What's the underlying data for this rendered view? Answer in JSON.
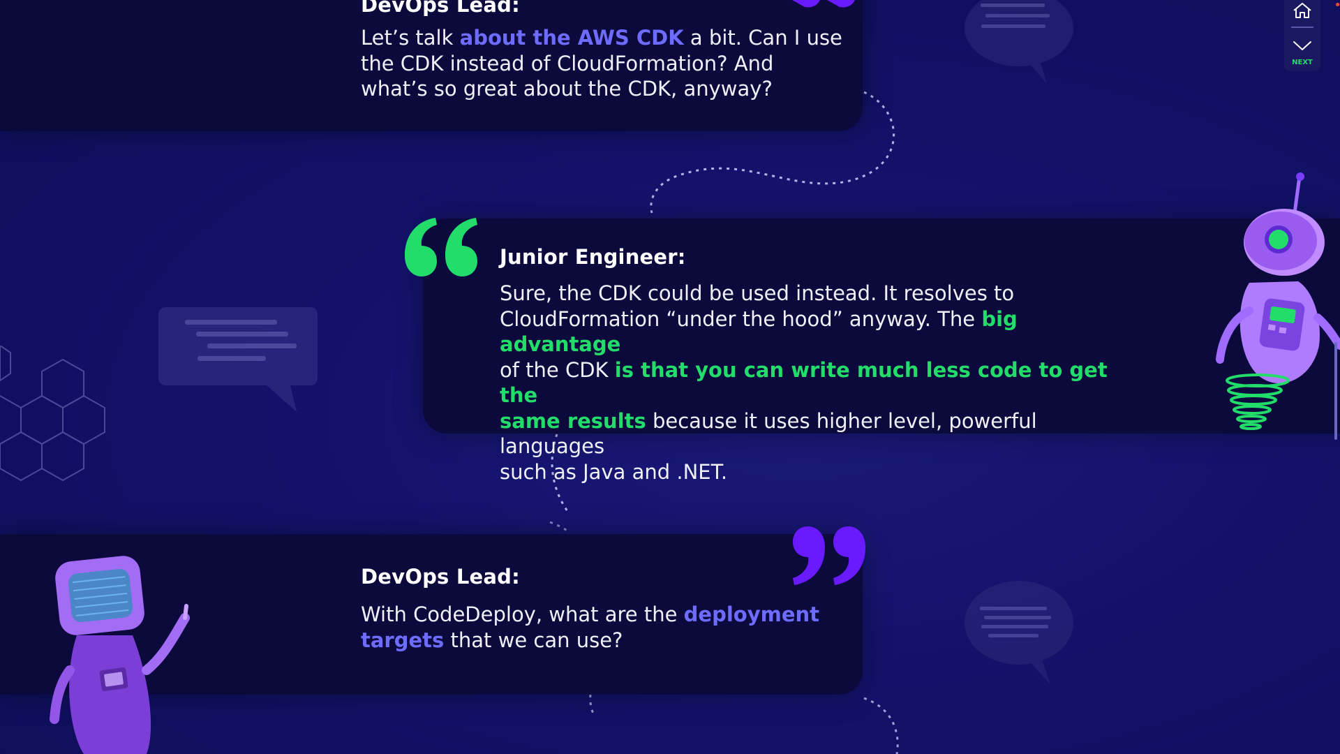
{
  "dialogue": [
    {
      "speaker": "DevOps Lead:",
      "segments": [
        {
          "text": "Let’s talk ",
          "style": "normal"
        },
        {
          "text": "about the AWS CDK",
          "style": "blue"
        },
        {
          "text": " a bit. Can I use",
          "style": "normal"
        }
      ],
      "line2": "the CDK instead of CloudFormation? And",
      "line3": "what’s so great about the CDK, anyway?"
    },
    {
      "speaker": "Junior Engineer:",
      "line1": "Sure, the CDK could be used instead. It resolves to",
      "line2_a": "CloudFormation “under the hood” anyway. The ",
      "line2_b": "big advantage",
      "line3_a": "of the CDK ",
      "line3_b": "is that you can write much less code to get the",
      "line4_a": "same results",
      "line4_b": " because it uses higher level, powerful languages",
      "line5": "such as Java and .NET."
    },
    {
      "speaker": "DevOps Lead:",
      "line1_a": "With CodeDeploy, what are the ",
      "line1_b": "deployment",
      "line2_a": "targets",
      "line2_b": " that we can use?"
    }
  ],
  "quote_marks": {
    "open": "“",
    "close": "”"
  },
  "nav": {
    "next_label": "NEXT",
    "home_icon": "home-icon",
    "next_icon": "chevron-down-icon"
  },
  "colors": {
    "background": "#12126a",
    "card": "#0c0a3c",
    "blue_highlight": "#6e6cff",
    "green_highlight": "#22dd6a",
    "purple_quote": "#6a1aff"
  }
}
